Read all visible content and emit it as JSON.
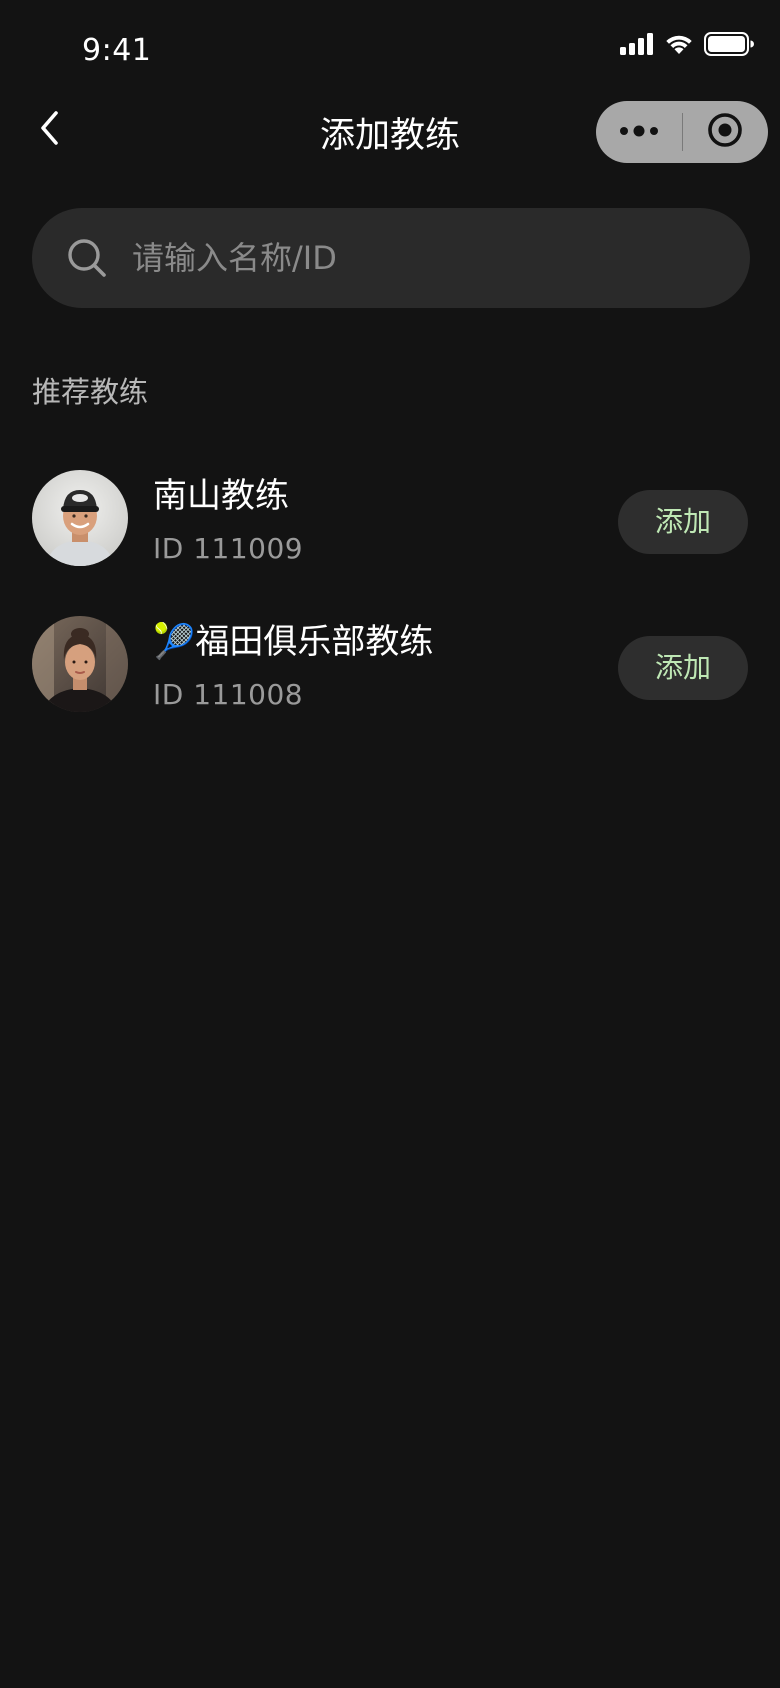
{
  "status_bar": {
    "time": "9:41"
  },
  "nav": {
    "title": "添加教练"
  },
  "search": {
    "placeholder": "请输入名称/ID",
    "value": ""
  },
  "section": {
    "title": "推荐教练"
  },
  "coaches": [
    {
      "name": "南山教练",
      "id_text": "ID 111009",
      "button_label": "添加"
    },
    {
      "name": "🎾福田俱乐部教练",
      "id_text": "ID 111008",
      "button_label": "添加"
    }
  ],
  "colors": {
    "background": "#131313",
    "search_bg": "#2a2a2a",
    "button_bg": "#2e2e2e",
    "button_text": "#bfe8b5",
    "secondary_text": "#9a9a9a",
    "capsule_bg": "#a8a8a8"
  },
  "icons": {
    "back": "chevron-left-icon",
    "more": "more-dots-icon",
    "close": "target-circle-icon",
    "search": "search-icon",
    "signal": "cellular-signal-icon",
    "wifi": "wifi-icon",
    "battery": "battery-icon"
  }
}
